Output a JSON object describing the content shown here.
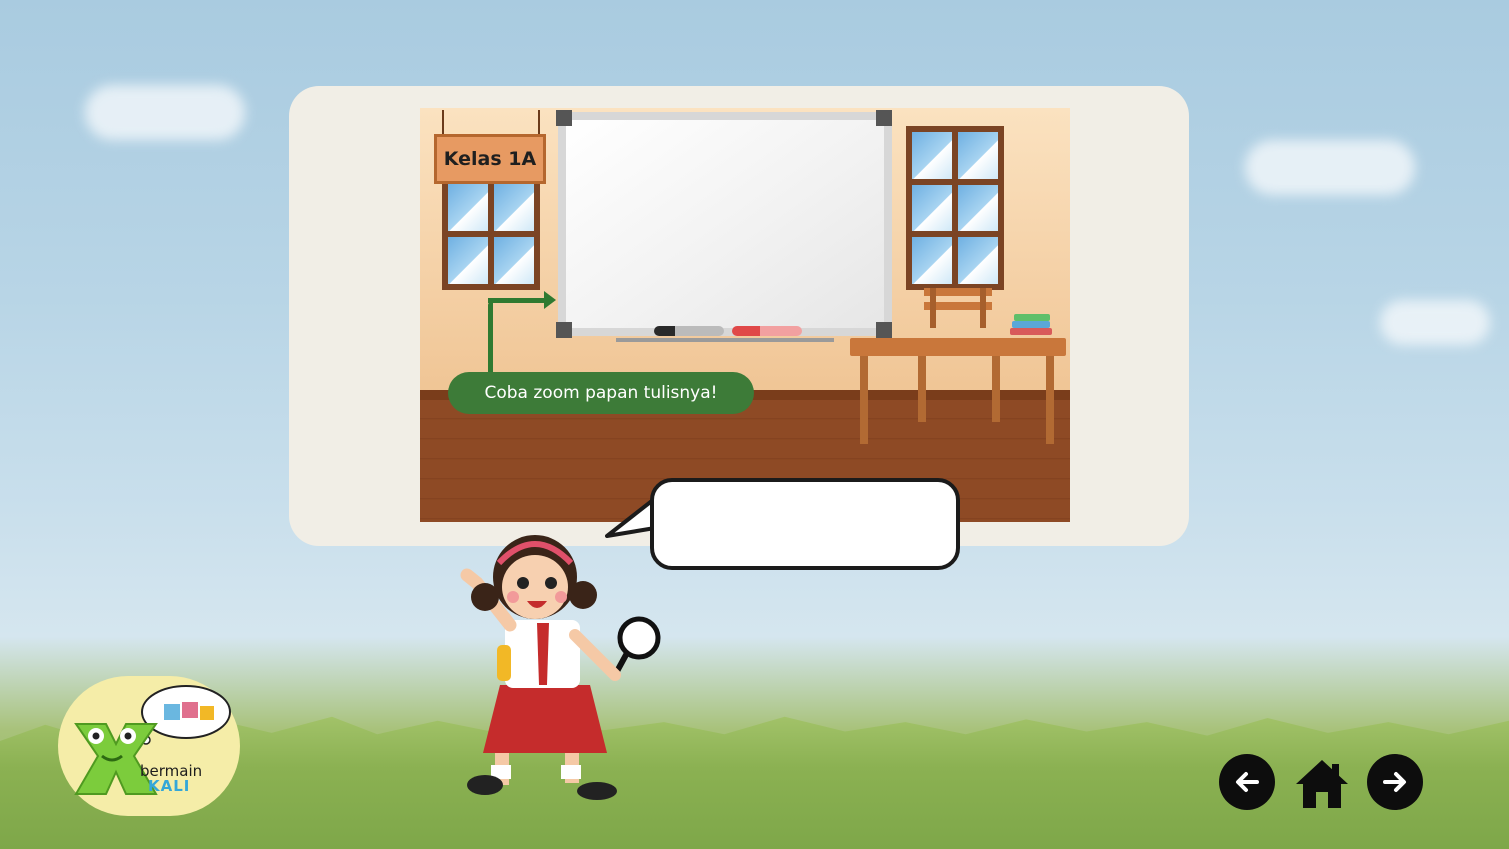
{
  "classroom": {
    "sign_label": "Kelas 1A",
    "hint_text": "Coba zoom papan tulisnya!"
  },
  "speech_bubble": {
    "text": ""
  },
  "logo": {
    "line1": "bermain",
    "line2": "KALI"
  },
  "navigation": {
    "back_icon": "arrow-left-icon",
    "home_icon": "home-icon",
    "next_icon": "arrow-right-icon"
  },
  "colors": {
    "hint_green": "#3d7b38",
    "nav_black": "#0d0d0d",
    "logo_blue": "#35a7d8"
  }
}
